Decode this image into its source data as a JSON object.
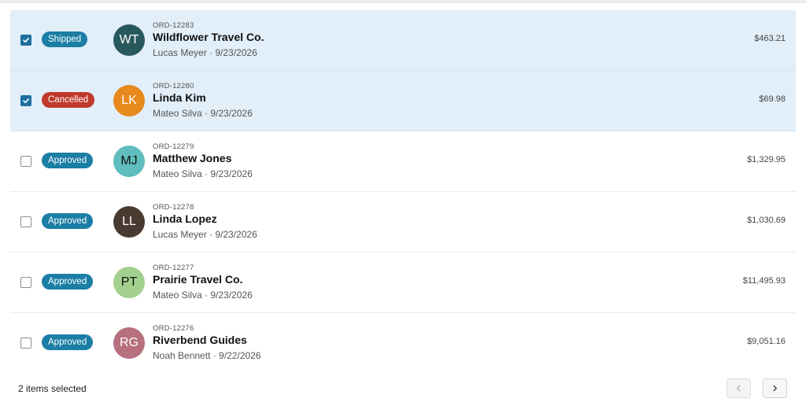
{
  "orders": [
    {
      "selected": true,
      "status": "Shipped",
      "status_color": "#1b7ea5",
      "initials": "WT",
      "avatar_color": "#27585c",
      "avatar_dark": true,
      "order_id": "ORD-12283",
      "name": "Wildflower Travel Co.",
      "meta": "Lucas Meyer · 9/23/2026",
      "amount": "$463.21"
    },
    {
      "selected": true,
      "status": "Cancelled",
      "status_color": "#c0392b",
      "initials": "LK",
      "avatar_color": "#e8891e",
      "avatar_dark": true,
      "order_id": "ORD-12280",
      "name": "Linda Kim",
      "meta": "Mateo Silva · 9/23/2026",
      "amount": "$69.98"
    },
    {
      "selected": false,
      "status": "Approved",
      "status_color": "#1b7ea5",
      "initials": "MJ",
      "avatar_color": "#5fbdbd",
      "avatar_dark": false,
      "order_id": "ORD-12279",
      "name": "Matthew Jones",
      "meta": "Mateo Silva · 9/23/2026",
      "amount": "$1,329.95"
    },
    {
      "selected": false,
      "status": "Approved",
      "status_color": "#1b7ea5",
      "initials": "LL",
      "avatar_color": "#4a3b32",
      "avatar_dark": true,
      "order_id": "ORD-12278",
      "name": "Linda Lopez",
      "meta": "Lucas Meyer · 9/23/2026",
      "amount": "$1,030.69"
    },
    {
      "selected": false,
      "status": "Approved",
      "status_color": "#1b7ea5",
      "initials": "PT",
      "avatar_color": "#a3d08e",
      "avatar_dark": false,
      "order_id": "ORD-12277",
      "name": "Prairie Travel Co.",
      "meta": "Mateo Silva · 9/23/2026",
      "amount": "$11,495.93"
    },
    {
      "selected": false,
      "status": "Approved",
      "status_color": "#1b7ea5",
      "initials": "RG",
      "avatar_color": "#b8707e",
      "avatar_dark": true,
      "order_id": "ORD-12276",
      "name": "Riverbend Guides",
      "meta": "Noah Bennett · 9/22/2026",
      "amount": "$9,051.16"
    }
  ],
  "footer": {
    "selected_text": "2 items selected",
    "prev_icon": "chevron-left-icon",
    "next_icon": "chevron-right-icon"
  }
}
